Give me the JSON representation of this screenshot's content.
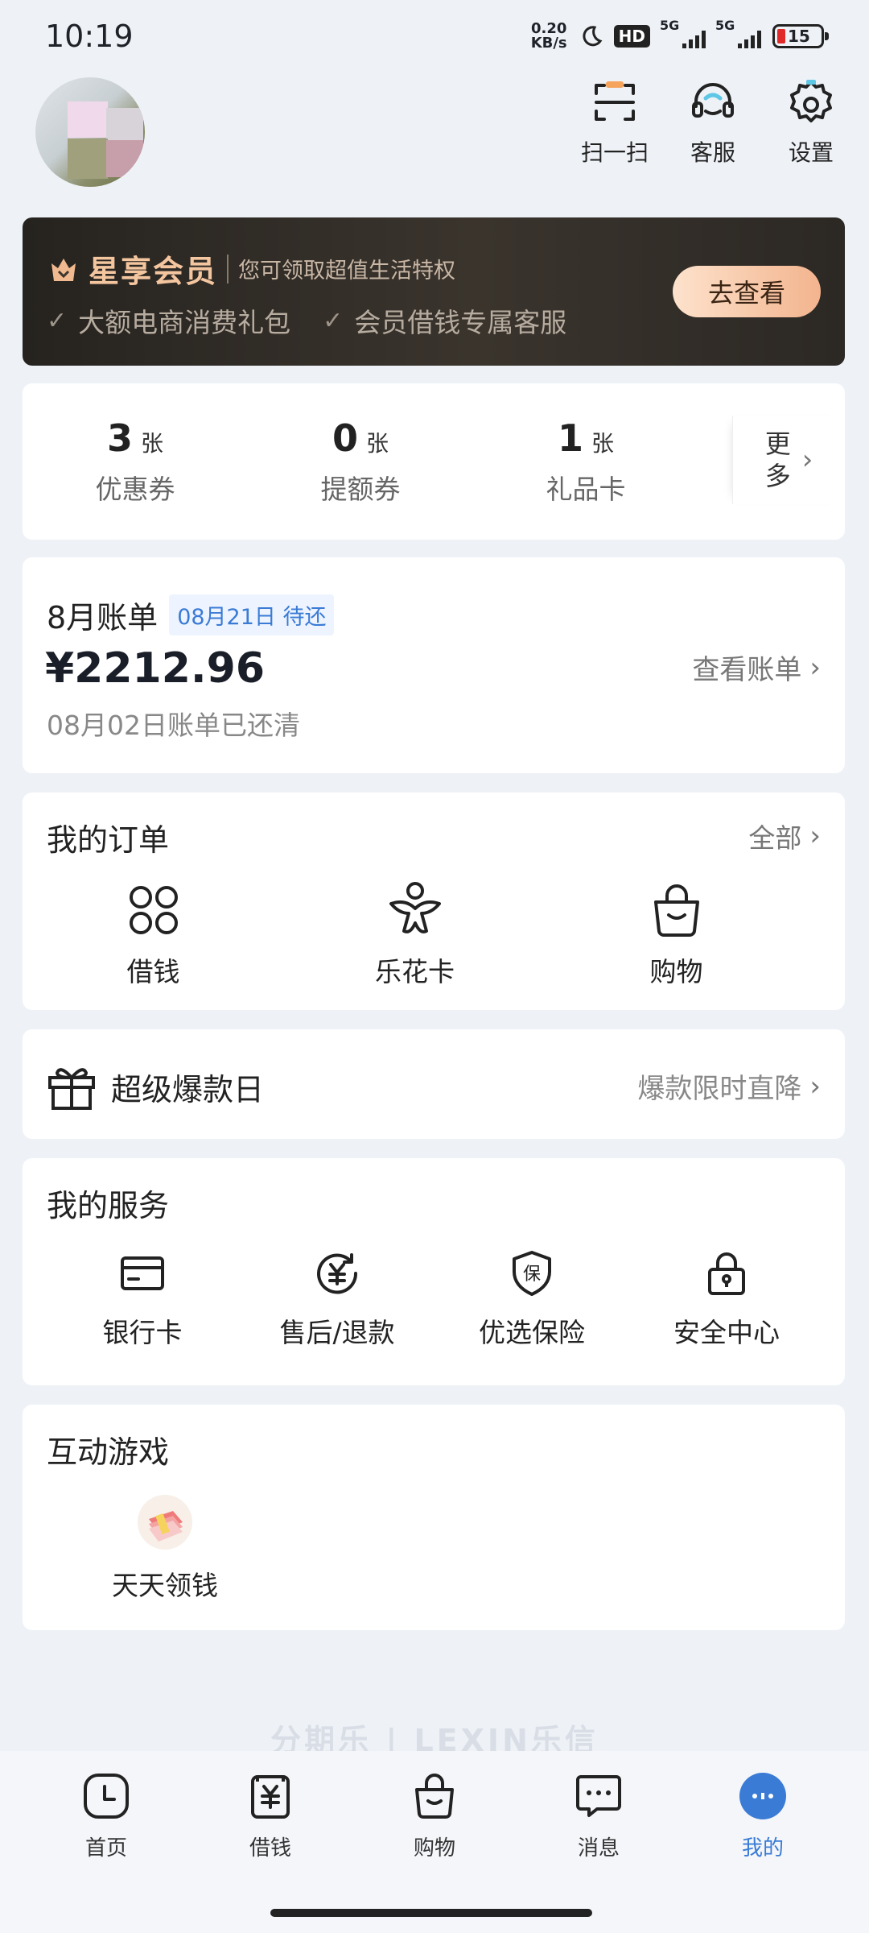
{
  "status_bar": {
    "time": "10:19",
    "net_speed_value": "0.20",
    "net_speed_unit": "KB/s",
    "hd_label": "HD",
    "signal1_label": "5G",
    "signal2_label": "5G",
    "battery": "15"
  },
  "header": {
    "actions": [
      {
        "label": "扫一扫",
        "icon": "scan-icon"
      },
      {
        "label": "客服",
        "icon": "headset-icon"
      },
      {
        "label": "设置",
        "icon": "gear-icon"
      }
    ]
  },
  "vip": {
    "name": "星享会员",
    "desc": "您可领取超值生活特权",
    "perks": [
      "大额电商消费礼包",
      "会员借钱专属客服"
    ],
    "button": "去查看",
    "colors": {
      "name": "#f4c6a0",
      "button_start": "#fde2cc",
      "button_end": "#f3b48e"
    }
  },
  "coupons": {
    "items": [
      {
        "count": "3",
        "unit": "张",
        "label": "优惠券"
      },
      {
        "count": "0",
        "unit": "张",
        "label": "提额券"
      },
      {
        "count": "1",
        "unit": "张",
        "label": "礼品卡"
      }
    ],
    "more": "更多"
  },
  "bill": {
    "title": "8月账单",
    "tag": "08月21日 待还",
    "amount": "¥2212.96",
    "note": "08月02日账单已还清",
    "link": "查看账单"
  },
  "orders": {
    "title": "我的订单",
    "link": "全部",
    "items": [
      {
        "label": "借钱",
        "icon": "clover-icon"
      },
      {
        "label": "乐花卡",
        "icon": "flower-card-icon"
      },
      {
        "label": "购物",
        "icon": "shopping-bag-icon"
      }
    ]
  },
  "promo": {
    "title": "超级爆款日",
    "link": "爆款限时直降",
    "icon": "gift-icon"
  },
  "services": {
    "title": "我的服务",
    "items": [
      {
        "label": "银行卡",
        "icon": "bank-card-icon"
      },
      {
        "label": "售后/退款",
        "icon": "refund-icon"
      },
      {
        "label": "优选保险",
        "icon": "insurance-shield-icon"
      },
      {
        "label": "安全中心",
        "icon": "lock-icon"
      }
    ]
  },
  "games": {
    "title": "互动游戏",
    "items": [
      {
        "label": "天天领钱",
        "icon": "money-stack-icon"
      }
    ]
  },
  "brand": "分期乐 | LEXIN乐信",
  "tabbar": {
    "items": [
      {
        "label": "首页",
        "icon": "clock-home-icon"
      },
      {
        "label": "借钱",
        "icon": "yuan-doc-icon"
      },
      {
        "label": "购物",
        "icon": "shopping-bag-icon"
      },
      {
        "label": "消息",
        "icon": "chat-bubble-icon"
      },
      {
        "label": "我的",
        "icon": "profile-dot-icon"
      }
    ],
    "active_index": 4,
    "active_color": "#3a7bd5"
  }
}
